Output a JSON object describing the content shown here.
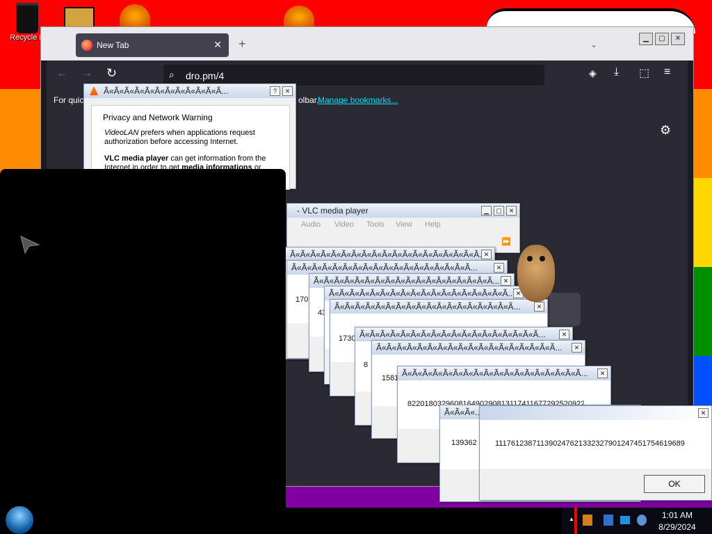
{
  "desktop": {
    "stripe_colors": [
      "#ff0000",
      "#ff8c00",
      "#ffd700",
      "#008f00",
      "#0050ff",
      "#8000a0"
    ],
    "icons": [
      {
        "label": "Recycle B",
        "icon": "recycle-bin-icon"
      },
      {
        "label": "",
        "icon": "folder-icon"
      },
      {
        "label": "",
        "icon": "app-icon"
      },
      {
        "label": "",
        "icon": "app-icon"
      }
    ]
  },
  "browser": {
    "tab_title": "New Tab",
    "url": "dro.pm/4",
    "bookmarks_left": "For quic",
    "bookmarks_right": "olbar.",
    "manage_bookmarks": "Manage bookmarks..."
  },
  "vlc_privacy": {
    "title": "Ã«Ã«Ã«Ã«Ã«Ã«Ã«Ã«Ã«Ã«Ã«Ã...",
    "section": "Privacy and Network Warning",
    "para1_italic": "VideoLAN",
    "para1_rest": " prefers when applications request authorization before accessing Internet.",
    "para2_bold": "VLC media player",
    "para2_rest": " can get information from the Internet in order to get ",
    "para2_bold2": "media informations",
    "para2_tail": " or"
  },
  "vlc_player": {
    "title": "- VLC media player",
    "menu": [
      "Audio",
      "Video",
      "Tools",
      "View",
      "Help"
    ]
  },
  "dialogs": [
    {
      "title": "Ã«Ã«Ã«Ã«Ã«Ã«Ã«Ã«Ã«Ã«Ã«Ã«Ã«Ã«Ã«Ã«Ã«Ã«Ã...",
      "text": ""
    },
    {
      "title": "Ã«Ã«Ã«Ã«Ã«Ã«Ã«Ã«Ã«Ã«Ã«Ã«Ã«Ã«Ã«Ã«Ã«Ã...",
      "text": "170"
    },
    {
      "title": "Ã«Ã«Ã«Ã«Ã«Ã«Ã«Ã«Ã«Ã«Ã«Ã«Ã«Ã«Ã«Ã«Ã«Ã...",
      "text": "43"
    },
    {
      "title": "Ã«Ã«Ã«Ã«Ã«Ã«Ã«Ã«Ã«Ã«Ã«Ã«Ã«Ã«Ã«Ã«Ã«Ã...",
      "text": ""
    },
    {
      "title": "Ã«Ã«Ã«Ã«Ã«Ã«Ã«Ã«Ã«Ã«Ã«Ã«Ã«Ã«Ã«Ã«Ã«Ã...",
      "text": "1730"
    },
    {
      "title": "Ã«Ã«Ã«Ã«Ã«Ã«Ã«Ã«Ã«Ã«Ã«Ã«Ã«Ã«Ã«Ã«Ã«Ã...",
      "text": "8"
    },
    {
      "title": "Ã«Ã«Ã«Ã«Ã«Ã«Ã«Ã«Ã«Ã«Ã«Ã«Ã«Ã«Ã«Ã«Ã«Ã...",
      "text": "1581"
    },
    {
      "title": "Ã«Ã«Ã«Ã«Ã«Ã«Ã«Ã«Ã«Ã«Ã«Ã«Ã«Ã«Ã«Ã«Ã«Ã...",
      "text": "822018032960816490290813117411677292520922"
    },
    {
      "title": "Ã«Ã«Ã«...",
      "text": "139362"
    }
  ],
  "front_dialog": {
    "number": "1117612387113902476213323279012474517546196​89",
    "ok": "OK"
  },
  "taskbar": {
    "time": "1:01 AM",
    "date": "8/29/2024"
  }
}
